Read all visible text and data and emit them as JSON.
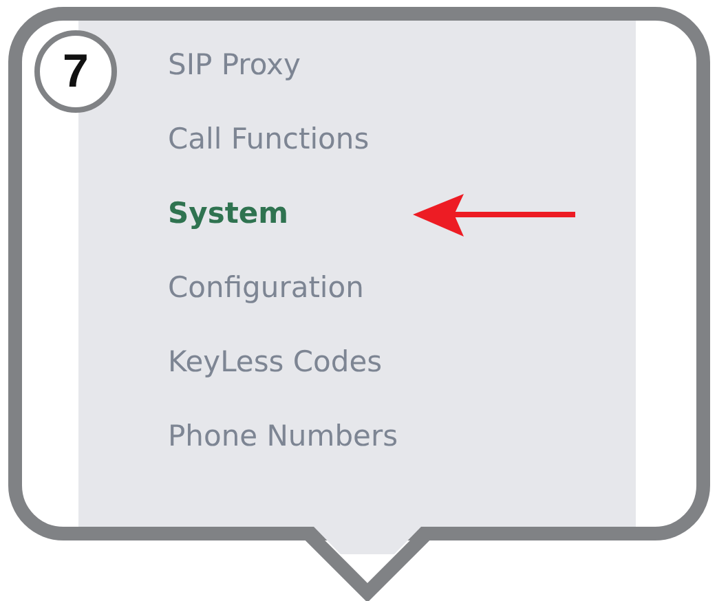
{
  "callout": {
    "step_badge": "7"
  },
  "menu": {
    "items": [
      {
        "label": "SIP Proxy",
        "selected": false
      },
      {
        "label": "Call Functions",
        "selected": false
      },
      {
        "label": "System",
        "selected": true
      },
      {
        "label": "Configuration",
        "selected": false
      },
      {
        "label": "KeyLess Codes",
        "selected": false
      },
      {
        "label": "Phone Numbers",
        "selected": false
      }
    ]
  }
}
